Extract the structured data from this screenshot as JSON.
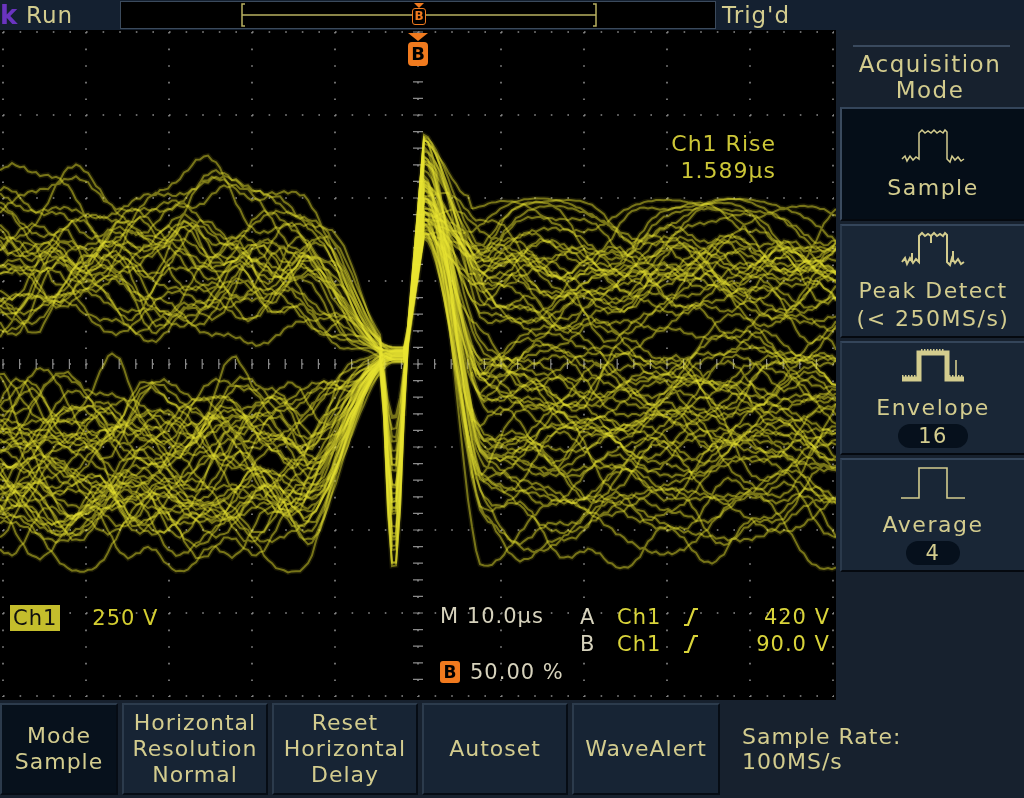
{
  "status_bar": {
    "logo_letter": "k",
    "run_state": "Run",
    "record_marker": "B",
    "trigger_state": "Trig'd"
  },
  "display": {
    "trigger_marker": "B",
    "measurement": {
      "label": "Ch1 Rise",
      "value": "1.589µs"
    },
    "channel": {
      "name": "Ch1",
      "scale": "250 V"
    },
    "timebase": "M 10.0µs",
    "triggers": [
      {
        "label": "A",
        "source": "Ch1",
        "rising": true,
        "threshold": "420 V"
      },
      {
        "label": "B",
        "source": "Ch1",
        "rising": true,
        "threshold": "90.0 V"
      }
    ],
    "position": {
      "marker": "B",
      "value": "50.00 %"
    }
  },
  "side_menu": {
    "title": "Acquisition Mode",
    "items": [
      {
        "kind": "sample",
        "label": "Sample",
        "selected": true
      },
      {
        "kind": "peak_detect",
        "label": "Peak Detect",
        "sublabel": "(< 250MS/s)",
        "selected": false
      },
      {
        "kind": "envelope",
        "label": "Envelope",
        "count": "16",
        "selected": false
      },
      {
        "kind": "average",
        "label": "Average",
        "count": "4",
        "selected": false
      }
    ]
  },
  "bottom_menu": {
    "buttons": [
      {
        "lines": [
          "Mode",
          "Sample"
        ],
        "selected": true
      },
      {
        "lines": [
          "Horizontal",
          "Resolution",
          "Normal"
        ],
        "selected": false
      },
      {
        "lines": [
          "Reset",
          "Horizontal",
          "Delay"
        ],
        "selected": false
      },
      {
        "lines": [
          "Autoset"
        ],
        "selected": false
      },
      {
        "lines": [
          "WaveAlert"
        ],
        "selected": false
      }
    ],
    "info": {
      "label": "Sample Rate:",
      "value": "100MS/s"
    }
  }
}
